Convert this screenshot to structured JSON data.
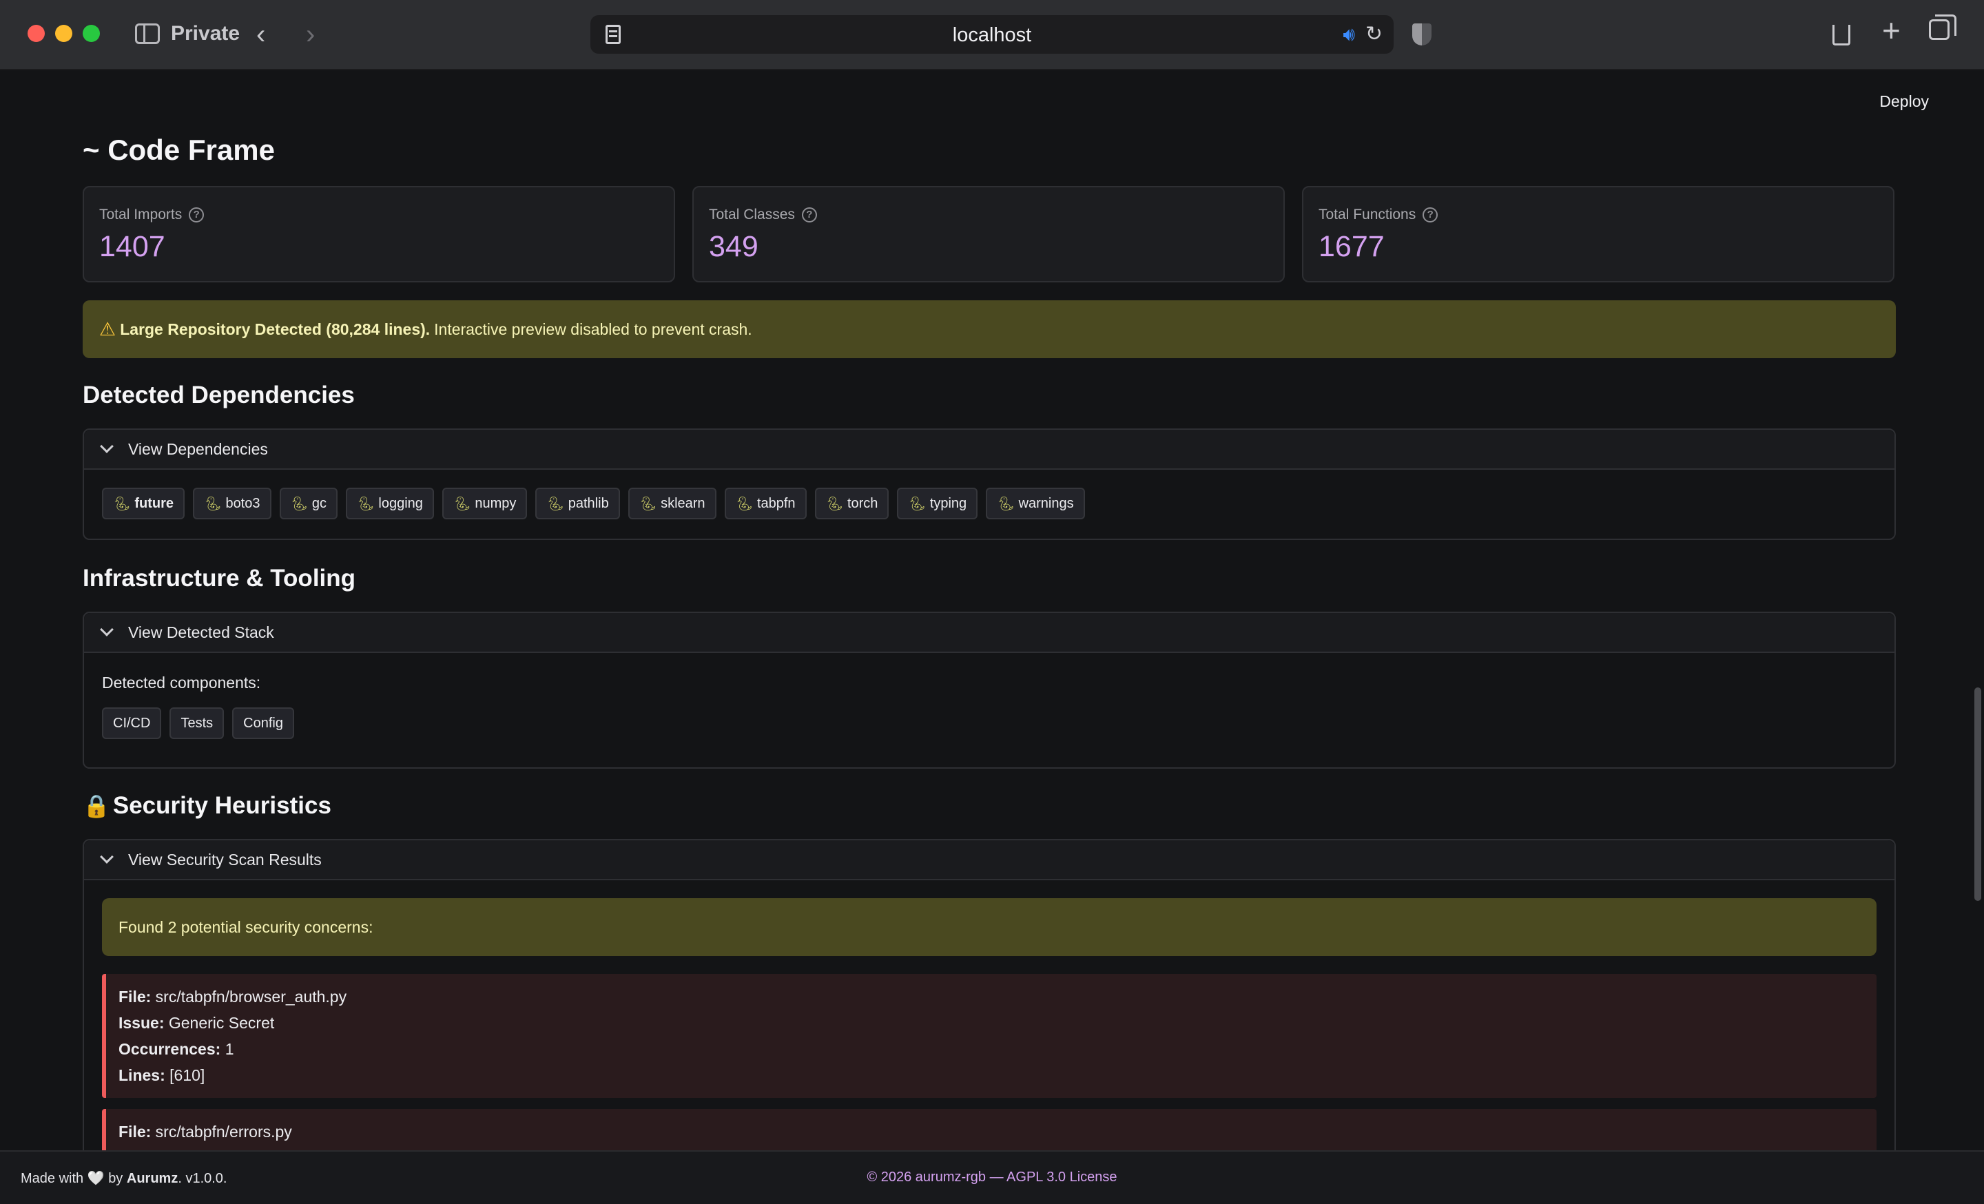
{
  "browser": {
    "private_label": "Private",
    "url": "localhost"
  },
  "app": {
    "deploy_label": "Deploy",
    "title": "~ Code Frame",
    "metrics": [
      {
        "label": "Total Imports",
        "value": "1407"
      },
      {
        "label": "Total Classes",
        "value": "349"
      },
      {
        "label": "Total Functions",
        "value": "1677"
      }
    ],
    "warning": {
      "icon": "⚠",
      "strong": "Large Repository Detected (80,284 lines).",
      "text": "Interactive preview disabled to prevent crash."
    },
    "dependencies": {
      "heading": "Detected Dependencies",
      "expander_label": "View Dependencies",
      "items": [
        "future",
        "boto3",
        "gc",
        "logging",
        "numpy",
        "pathlib",
        "sklearn",
        "tabpfn",
        "torch",
        "typing",
        "warnings"
      ]
    },
    "infrastructure": {
      "heading": "Infrastructure & Tooling",
      "expander_label": "View Detected Stack",
      "components_label": "Detected components:",
      "items": [
        "CI/CD",
        "Tests",
        "Config"
      ]
    },
    "security": {
      "heading_icon": "🔒",
      "heading": "Security Heuristics",
      "expander_label": "View Security Scan Results",
      "summary": "Found 2 potential security concerns:",
      "labels": {
        "file": "File:",
        "issue": "Issue:",
        "occurrences": "Occurrences:",
        "lines": "Lines:"
      },
      "findings": [
        {
          "file": "src/tabpfn/browser_auth.py",
          "issue": "Generic Secret",
          "occurrences": "1",
          "lines": "[610]"
        },
        {
          "file": "src/tabpfn/errors.py"
        }
      ]
    }
  },
  "footer": {
    "made_with": "Made with",
    "heart": "🤍",
    "by": "by",
    "author": "Aurumz",
    "version": ". v1.0.0.",
    "copyright": "© 2026 aurumz-rgb — AGPL 3.0 License"
  },
  "colors": {
    "accent": "#d4a1f0",
    "warning_bg": "#4a4920",
    "danger_border": "#ef5b5b",
    "danger_bg": "#2a1b1d"
  }
}
